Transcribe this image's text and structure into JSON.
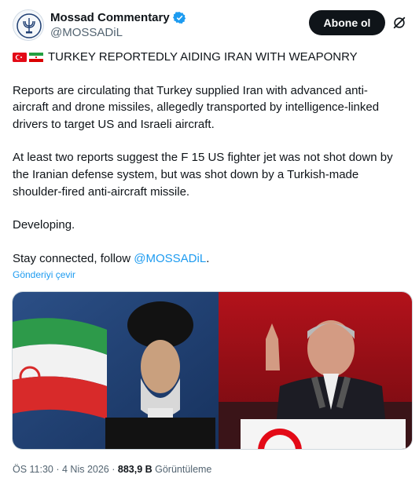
{
  "author": {
    "display_name": "Mossad Commentary",
    "handle": "@MOSSADiL",
    "verified_icon": "verified-badge-icon",
    "avatar_icon": "mossad-emblem-avatar"
  },
  "actions": {
    "follow_label": "Abone ol",
    "grok_icon": "grok-slash-icon"
  },
  "tweet": {
    "headline": "TURKEY REPORTEDLY AIDING IRAN WITH WEAPONRY",
    "flags": [
      "turkey-flag-icon",
      "iran-flag-icon"
    ],
    "para1_line1": "Reports are circulating  that Turkey supplied Iran with advanced anti-",
    "para1_line2": "aircraft and drone missiles, allegedly transported by intelligence-linked",
    "para1_line3": "drivers to target US and Israeli aircraft.",
    "para2_line1": "At least two reports suggest the F 15 US fighter jet was not shot down by",
    "para2_line2": "the Iranian defense system, but was shot down by a Turkish-made",
    "para2_line3": "shoulder-fired anti-aircraft missile.",
    "para3": "Developing.",
    "follow_prefix": "Stay connected, follow ",
    "follow_mention": "@MOSSADiL",
    "follow_suffix": "."
  },
  "translate_label": "Gönderiyi çevir",
  "meta": {
    "time": "ÖS 11:30",
    "sep1": " · ",
    "date": "4 Nis 2026",
    "sep2": " · ",
    "views": "883,9 B",
    "views_label": " Görüntüleme"
  },
  "colors": {
    "accent": "#1d9bf0",
    "text": "#0f1419",
    "secondary": "#536471",
    "button_bg": "#0f1419"
  }
}
